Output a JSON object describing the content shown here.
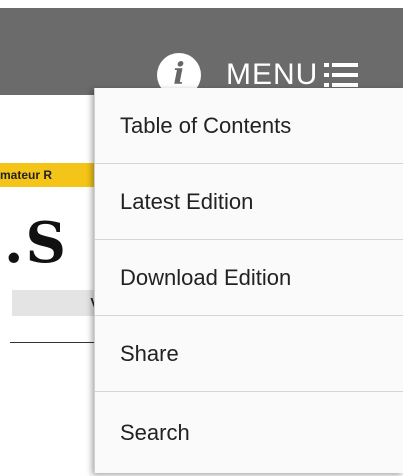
{
  "header": {
    "info_icon_glyph": "i",
    "menu_label": "MENU"
  },
  "background": {
    "tag_text": "mateur R",
    "big_text": "․S",
    "vol_text": "Vo"
  },
  "menu": {
    "items": [
      {
        "label": "Table of Contents"
      },
      {
        "label": "Latest Edition"
      },
      {
        "label": "Download Edition"
      },
      {
        "label": "Share"
      },
      {
        "label": "Search"
      }
    ]
  },
  "colors": {
    "header_bg": "#6b6b6b",
    "tag_bg": "#f4c518",
    "menu_bg": "#fafafa"
  }
}
